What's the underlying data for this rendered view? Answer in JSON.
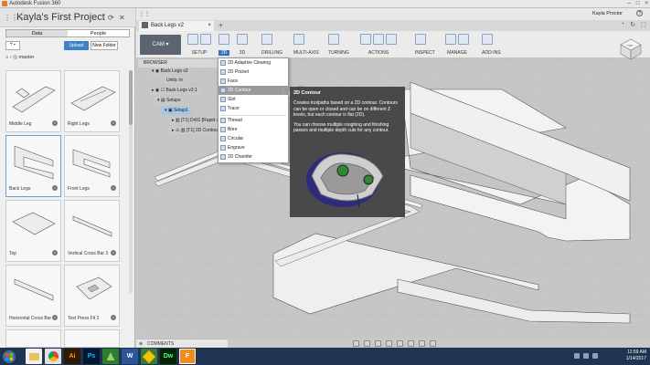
{
  "window": {
    "title": "Autodesk Fusion 360",
    "controls": [
      "–",
      "□",
      "×"
    ]
  },
  "header": {
    "project": "Kayla's First Project",
    "user": "Kayla Proctor",
    "help": "?"
  },
  "panel": {
    "tabs": [
      "Data",
      "People"
    ],
    "upload_label": "Upload",
    "new_folder_label": "New Folder",
    "breadcrumb": "master",
    "thumbnails": [
      "Middle Leg",
      "Right Legs",
      "Back Legs",
      "Front Legs",
      "Top",
      "Vertical Cross Bar 3",
      "Horizontal Cross Bar",
      "Test Press Fit 2"
    ]
  },
  "doc": {
    "tab_title": "Back Legs v2"
  },
  "toolbar": {
    "workspace": "CAM",
    "groups": [
      "SETUP",
      "2D",
      "3D",
      "DRILLING",
      "MULTI-AXIS",
      "TURNING",
      "ACTIONS",
      "INSPECT",
      "MANAGE",
      "ADD-INS"
    ]
  },
  "browser": {
    "header": "BROWSER",
    "items": [
      "Back Legs v2",
      "Units: in",
      "Back Legs v2:1",
      "Setups",
      "Setup1",
      "[T1] Drill1 [Rapid sr",
      "[T1] 2D Contour"
    ]
  },
  "menu_2d": {
    "items": [
      "2D Adaptive Clearing",
      "2D Pocket",
      "Face",
      "2D Contour",
      "Slot",
      "Trace",
      "Thread",
      "Bore",
      "Circular",
      "Engrave",
      "2D Chamfer"
    ],
    "highlighted_index": 3
  },
  "tooltip": {
    "title": "2D Contour",
    "desc1": "Creates toolpaths based on a 2D contour. Contours can be open or closed and can be on different Z levels, but each contour is flat (2D).",
    "desc2": "You can choose multiple roughing and finishing passes and multiple depth cuts for any contour."
  },
  "bottom": {
    "comments_label": "COMMENTS"
  },
  "viewcube": {
    "face_label": "TOP"
  },
  "taskbar": {
    "apps": [
      {
        "label": "Ai",
        "color": "#2d1a00",
        "fg": "#ff9a00"
      },
      {
        "label": "Ps",
        "color": "#001a33",
        "fg": "#31a8ff"
      },
      {
        "label": "",
        "color": "#2e7d32",
        "fg": "#fff"
      },
      {
        "label": "W",
        "color": "#2b579a",
        "fg": "#fff"
      },
      {
        "label": "",
        "color": "#3a7a3a",
        "fg": "#fff"
      },
      {
        "label": "Dw",
        "color": "#072401",
        "fg": "#4aff8a"
      },
      {
        "label": "F",
        "color": "#f08c1a",
        "fg": "#fff"
      }
    ],
    "time": "11:59 AM",
    "date": "1/14/2017"
  }
}
